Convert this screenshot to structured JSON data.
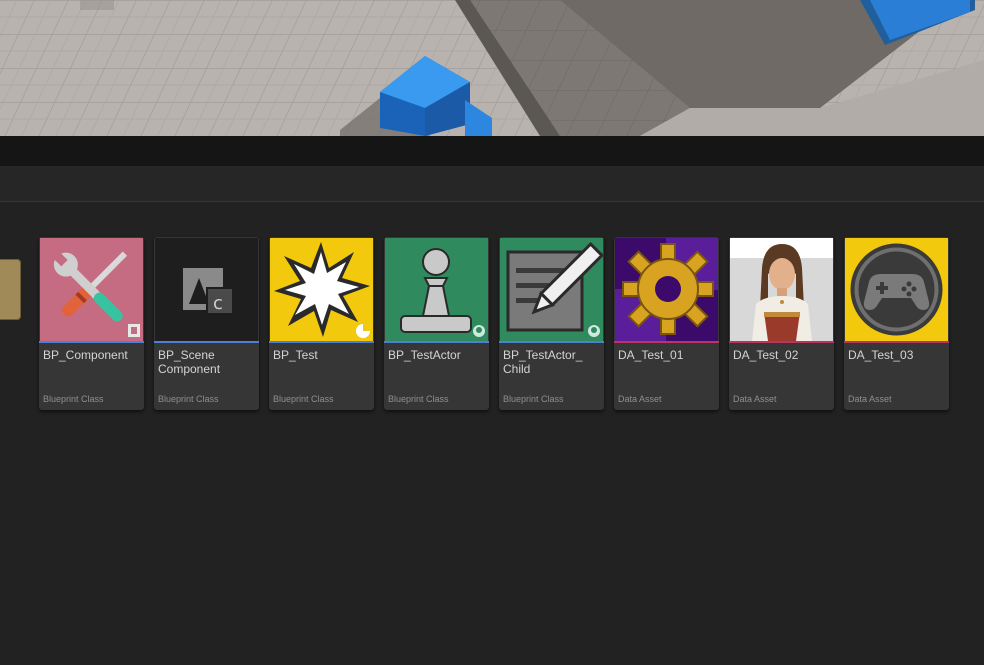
{
  "assets": [
    {
      "name": "BP_Component",
      "type": "Blueprint Class",
      "icon": "tools-icon",
      "bar_color": "#4f7fd2"
    },
    {
      "name": "BP_Scene\nComponent",
      "type": "Blueprint Class",
      "icon": "scene-component-icon",
      "bar_color": "#4f7fd2"
    },
    {
      "name": "BP_Test",
      "type": "Blueprint Class",
      "icon": "burst-icon",
      "bar_color": "#4f7fd2"
    },
    {
      "name": "BP_TestActor",
      "type": "Blueprint Class",
      "icon": "pawn-icon",
      "bar_color": "#4f7fd2"
    },
    {
      "name": "BP_TestActor_\nChild",
      "type": "Blueprint Class",
      "icon": "notepad-pencil-icon",
      "bar_color": "#4f7fd2"
    },
    {
      "name": "DA_Test_01",
      "type": "Data Asset",
      "icon": "gear-icon",
      "bar_color": "#b7355f"
    },
    {
      "name": "DA_Test_02",
      "type": "Data Asset",
      "icon": "character-portrait",
      "bar_color": "#b7355f"
    },
    {
      "name": "DA_Test_03",
      "type": "Data Asset",
      "icon": "gamepad-icon",
      "bar_color": "#b7355f"
    }
  ]
}
